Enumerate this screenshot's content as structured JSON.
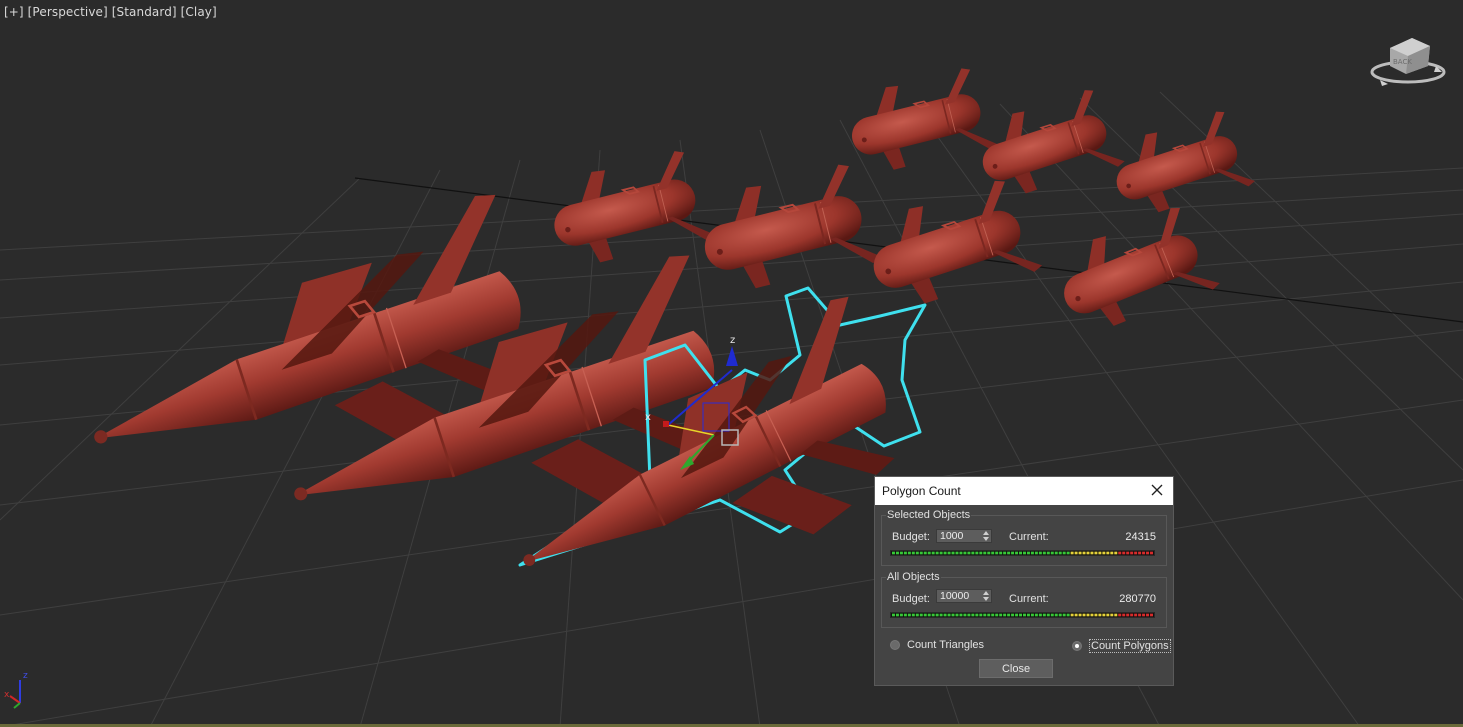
{
  "viewport": {
    "labels": [
      "[+]",
      "[Perspective]",
      "[Standard]",
      "[Clay]"
    ],
    "viewcube_face": "BACK",
    "axis_tripod": {
      "z": "z",
      "x": "x"
    },
    "gizmo": {
      "x": "x",
      "z": "z"
    }
  },
  "dialog": {
    "title": "Polygon Count",
    "selected": {
      "group_label": "Selected Objects",
      "budget_label": "Budget:",
      "budget_value": "1000",
      "current_label": "Current:",
      "current_value": "24315"
    },
    "all": {
      "group_label": "All Objects",
      "budget_label": "Budget:",
      "budget_value": "10000",
      "current_label": "Current:",
      "current_value": "280770"
    },
    "radio_triangles": "Count Triangles",
    "radio_polygons": "Count Polygons",
    "selected_mode": "polygons",
    "close_label": "Close"
  },
  "colors": {
    "viewport_bg": "#2b2b2b",
    "grid": "#3e3e3e",
    "model": "#a0392f",
    "selection_outline": "#3fe0ee",
    "meter_green": "#37c837",
    "meter_yellow": "#e6d23a",
    "meter_red": "#d82b2b"
  }
}
